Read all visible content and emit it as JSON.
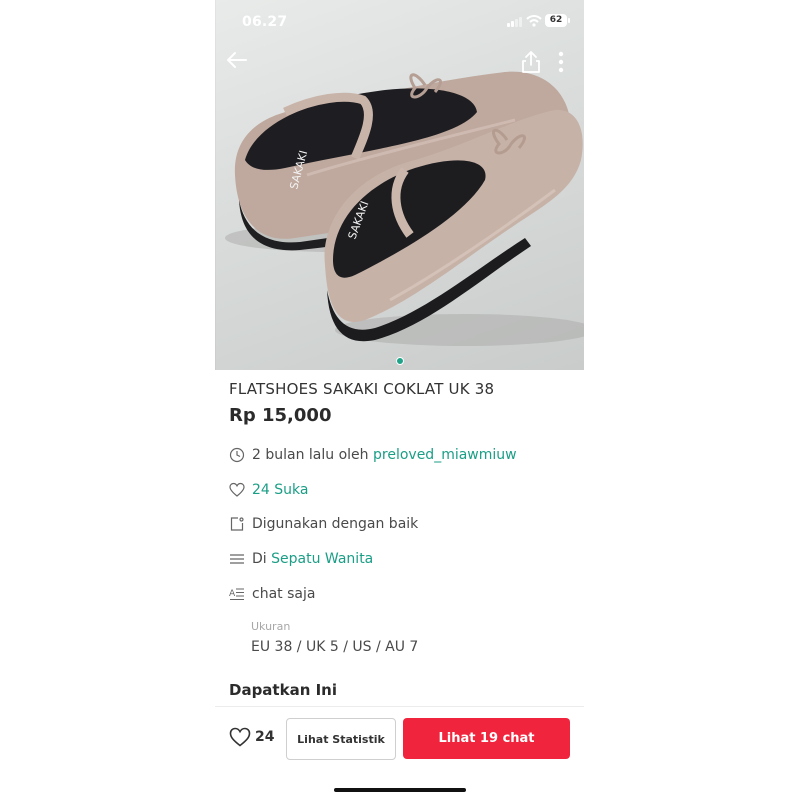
{
  "status_bar": {
    "time": "06.27",
    "battery": "62"
  },
  "nav": {
    "back_icon": "arrow-left-icon",
    "share_icon": "share-icon",
    "more_icon": "more-vertical-icon"
  },
  "product": {
    "title": "FLATSHOES SAKAKI COKLAT UK 38",
    "price": "Rp 15,000",
    "image_count": 1,
    "active_image": 1
  },
  "details": {
    "posted": {
      "prefix": "2 bulan lalu oleh",
      "seller": "preloved_miawmiuw",
      "icon": "clock-icon"
    },
    "likes": {
      "text": "24 Suka",
      "icon": "heart-icon"
    },
    "condition": {
      "text": "Digunakan dengan baik",
      "icon": "tag-icon"
    },
    "category": {
      "prefix": "Di",
      "name": "Sepatu Wanita",
      "icon": "list-icon"
    },
    "description": {
      "text": "chat saja",
      "icon": "text-icon"
    },
    "size": {
      "label": "Ukuran",
      "value": "EU 38 / UK 5 / US / AU 7"
    }
  },
  "section": {
    "title": "Dapatkan Ini"
  },
  "bottom_bar": {
    "like_count": "24",
    "stats_button": "Lihat Statistik",
    "chat_button": "Lihat 19 chat"
  },
  "colors": {
    "accent_teal": "#1b9e86",
    "cta_red": "#f0243d",
    "shoe": "#c7b2a7",
    "insole": "#1d1d20"
  }
}
